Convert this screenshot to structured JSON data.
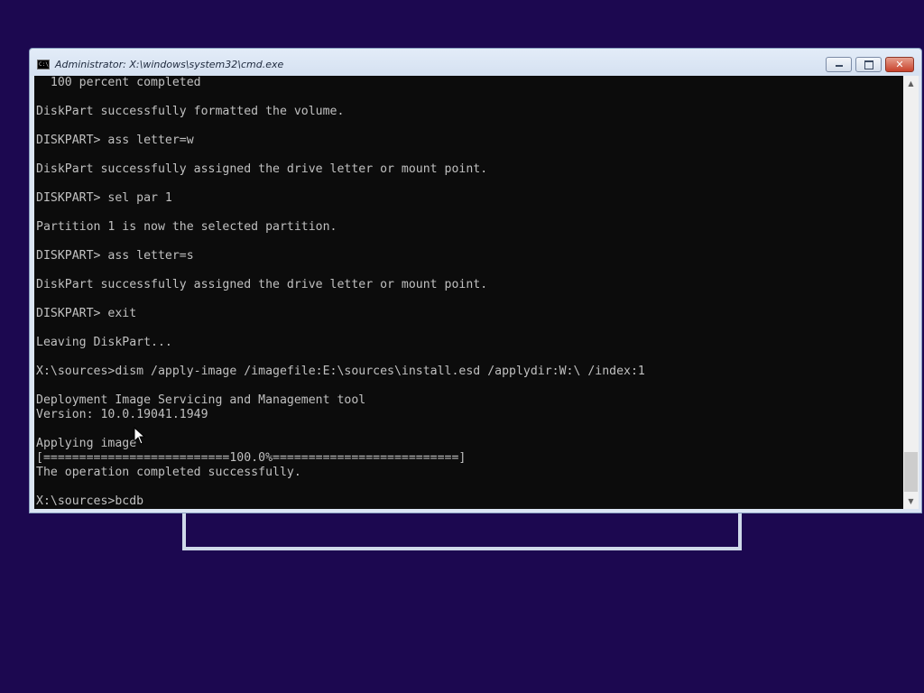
{
  "window": {
    "title": "Administrator: X:\\windows\\system32\\cmd.exe",
    "icon_glyph": "C:\\"
  },
  "controls": {
    "minimize_icon": "minimize-icon",
    "maximize_icon": "maximize-icon",
    "close_glyph": "✕"
  },
  "console": {
    "lines": [
      "  100 percent completed",
      "",
      "DiskPart successfully formatted the volume.",
      "",
      "DISKPART> ass letter=w",
      "",
      "DiskPart successfully assigned the drive letter or mount point.",
      "",
      "DISKPART> sel par 1",
      "",
      "Partition 1 is now the selected partition.",
      "",
      "DISKPART> ass letter=s",
      "",
      "DiskPart successfully assigned the drive letter or mount point.",
      "",
      "DISKPART> exit",
      "",
      "Leaving DiskPart...",
      "",
      "X:\\sources>dism /apply-image /imagefile:E:\\sources\\install.esd /applydir:W:\\ /index:1",
      "",
      "Deployment Image Servicing and Management tool",
      "Version: 10.0.19041.1949",
      "",
      "Applying image",
      "[==========================100.0%==========================]",
      "The operation completed successfully.",
      "",
      "X:\\sources>bcdb"
    ]
  },
  "scrollbar": {
    "up_glyph": "▲",
    "down_glyph": "▼"
  },
  "colors": {
    "desktop": "#1c0850",
    "console_bg": "#0c0c0c",
    "console_fg": "#c0c0c0",
    "close_button": "#c8412b"
  }
}
